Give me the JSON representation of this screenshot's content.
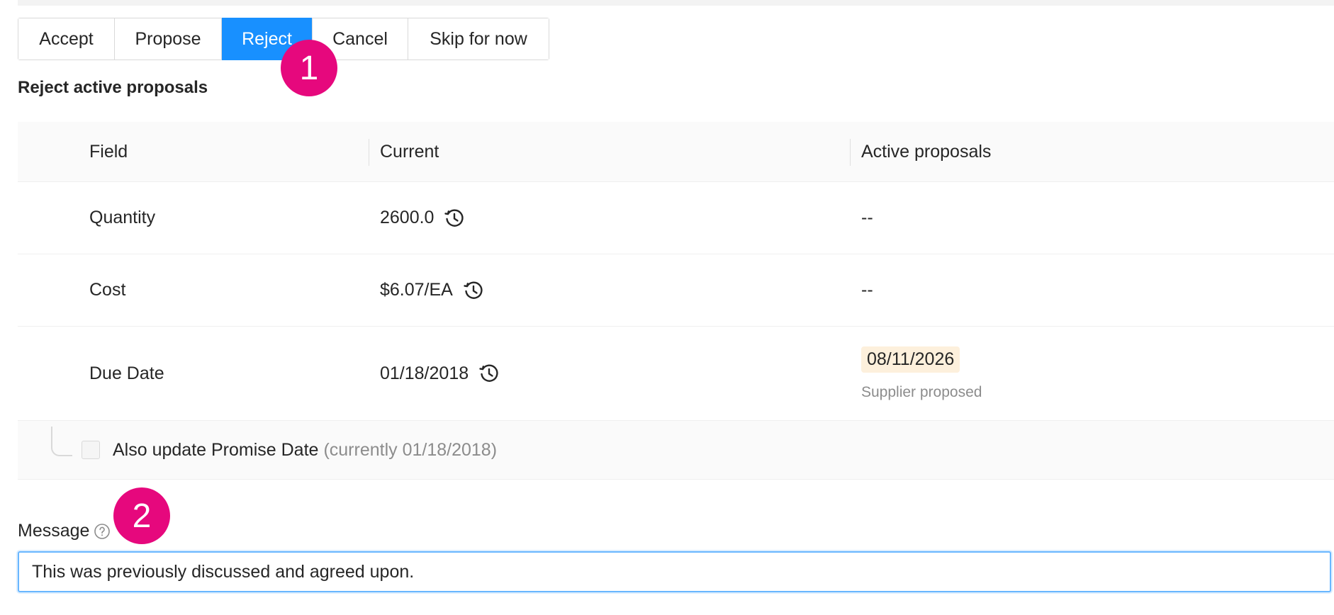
{
  "actions": {
    "accept": "Accept",
    "propose": "Propose",
    "reject": "Reject",
    "cancel": "Cancel",
    "skip": "Skip for now",
    "selected": "Reject"
  },
  "annotations": {
    "step1": "1",
    "step2": "2",
    "color": "#e6087d"
  },
  "section_title": "Reject active proposals",
  "table": {
    "headers": {
      "field": "Field",
      "current": "Current",
      "active": "Active proposals"
    },
    "rows": [
      {
        "field": "Quantity",
        "current": "2600.0",
        "active": "--",
        "icon": "history-clock-icon"
      },
      {
        "field": "Cost",
        "current": "$6.07/EA",
        "active": "--",
        "icon": "history-clock-icon"
      },
      {
        "field": "Due Date",
        "current": "01/18/2018",
        "active": "08/11/2026",
        "active_note": "Supplier proposed",
        "icon": "history-clock-icon"
      }
    ],
    "promise": {
      "label": "Also update Promise Date",
      "note": "(currently 01/18/2018)",
      "checked": false
    }
  },
  "message": {
    "label": "Message",
    "value": "This was previously discussed and agreed upon.",
    "help_icon": "question-circle-icon"
  },
  "colors": {
    "primary": "#1890ff",
    "chip_bg": "#fdf0dc"
  }
}
